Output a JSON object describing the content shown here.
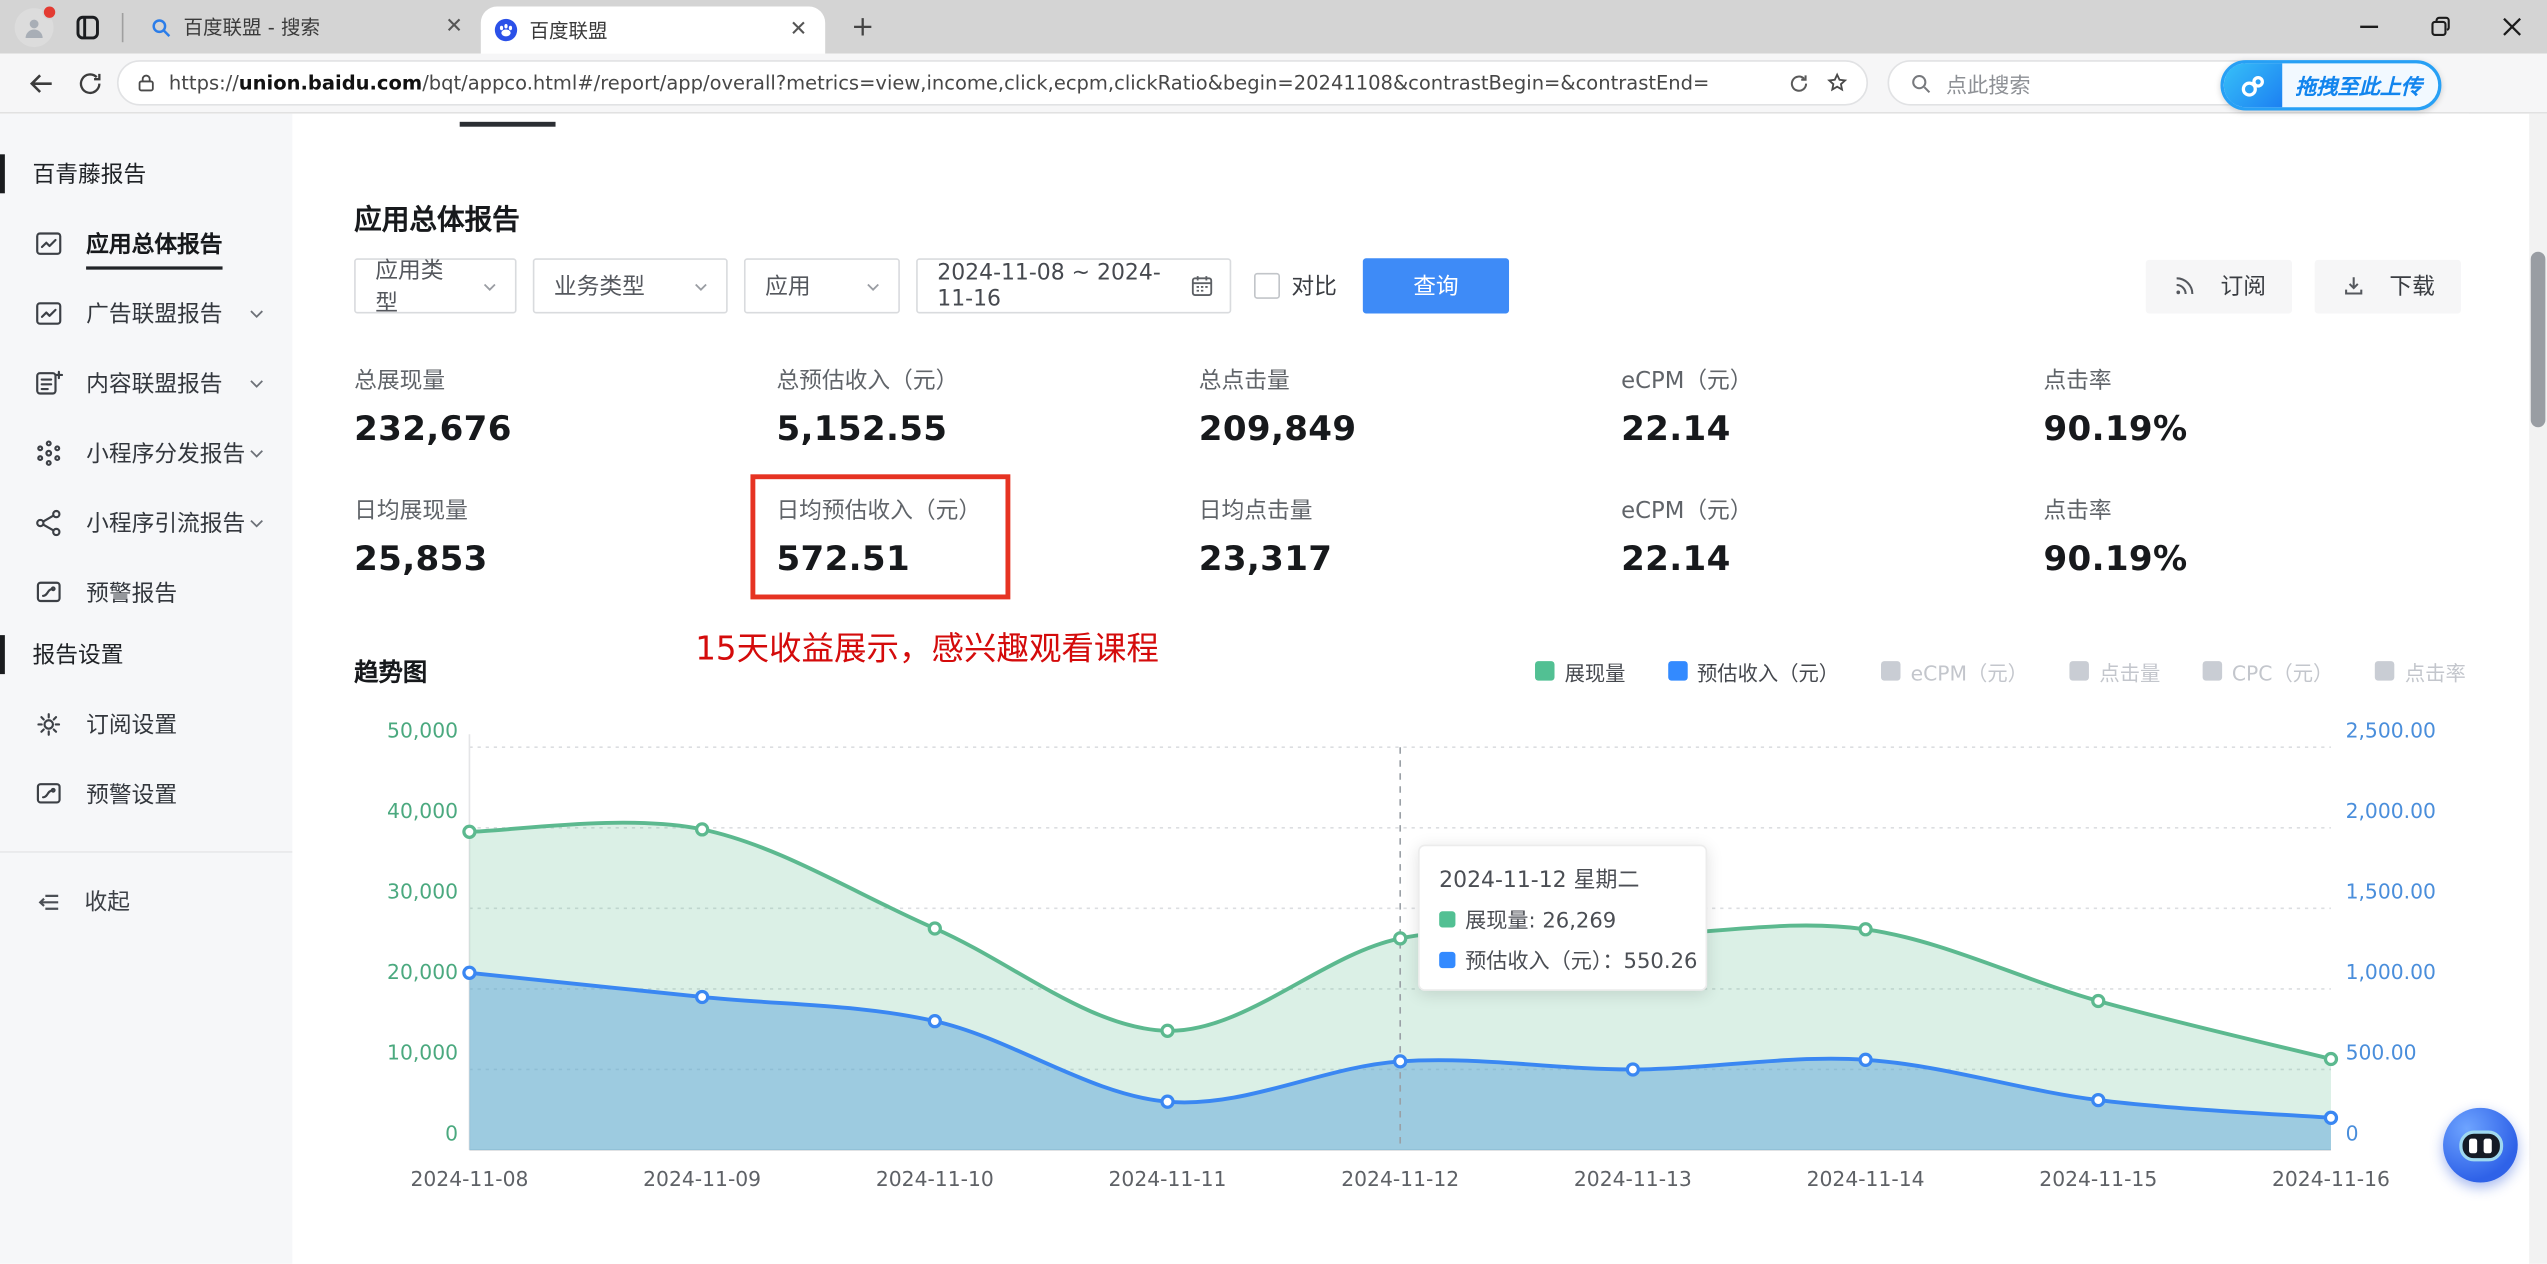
{
  "browser": {
    "tabs": [
      {
        "label": "百度联盟 - 搜索",
        "icon": "search-favicon",
        "active": false
      },
      {
        "label": "百度联盟",
        "icon": "baidu-favicon",
        "active": true
      }
    ],
    "url_protocol": "https://",
    "url_domain": "union.baidu.com",
    "url_path": "/bqt/appco.html#/report/app/overall?metrics=view,income,click,ecpm,clickRatio&begin=20241108&contrastBegin=&contrastEnd=",
    "search_placeholder": "点此搜索",
    "upload_button_label": "拖拽至此上传"
  },
  "sidebar": {
    "sections": [
      {
        "header": "百青藤报告",
        "items": [
          {
            "label": "应用总体报告",
            "icon": "report",
            "active": true,
            "chevron": false
          },
          {
            "label": "广告联盟报告",
            "icon": "report",
            "active": false,
            "chevron": true
          },
          {
            "label": "内容联盟报告",
            "icon": "content",
            "active": false,
            "chevron": true
          },
          {
            "label": "小程序分发报告",
            "icon": "dispatch",
            "active": false,
            "chevron": true
          },
          {
            "label": "小程序引流报告",
            "icon": "share",
            "active": false,
            "chevron": true
          },
          {
            "label": "预警报告",
            "icon": "alert",
            "active": false,
            "chevron": false
          }
        ]
      },
      {
        "header": "报告设置",
        "items": [
          {
            "label": "订阅设置",
            "icon": "gear",
            "active": false,
            "chevron": false
          },
          {
            "label": "预警设置",
            "icon": "alert",
            "active": false,
            "chevron": false
          }
        ]
      }
    ],
    "collapse_label": "收起"
  },
  "main": {
    "title": "应用总体报告",
    "filters": {
      "app_type": "应用类型",
      "biz_type": "业务类型",
      "app": "应用",
      "date_range": "2024-11-08 ~ 2024-11-16",
      "compare_label": "对比",
      "query_label": "查询"
    },
    "actions": {
      "subscribe_label": "订阅",
      "download_label": "下载"
    },
    "metrics_rows": [
      [
        {
          "label": "总展现量",
          "value": "232,676",
          "highlight": false
        },
        {
          "label": "总预估收入（元）",
          "value": "5,152.55",
          "highlight": false
        },
        {
          "label": "总点击量",
          "value": "209,849",
          "highlight": false
        },
        {
          "label": "eCPM（元）",
          "value": "22.14",
          "highlight": false
        },
        {
          "label": "点击率",
          "value": "90.19%",
          "highlight": false
        }
      ],
      [
        {
          "label": "日均展现量",
          "value": "25,853",
          "highlight": false
        },
        {
          "label": "日均预估收入（元）",
          "value": "572.51",
          "highlight": true
        },
        {
          "label": "日均点击量",
          "value": "23,317",
          "highlight": false
        },
        {
          "label": "eCPM（元）",
          "value": "22.14",
          "highlight": false
        },
        {
          "label": "点击率",
          "value": "90.19%",
          "highlight": false
        }
      ]
    ],
    "annotation": "15天收益展示，感兴趣观看课程",
    "chart_title": "趋势图"
  },
  "chart_data": {
    "type": "area",
    "title": "趋势图",
    "x": [
      "2024-11-08",
      "2024-11-09",
      "2024-11-10",
      "2024-11-11",
      "2024-11-12",
      "2024-11-13",
      "2024-11-14",
      "2024-11-15",
      "2024-11-16"
    ],
    "series": [
      {
        "name": "展现量",
        "axis": "left",
        "color": "#5cb98f",
        "fill": "rgba(92,185,143,0.22)",
        "values": [
          39500,
          39800,
          27500,
          14800,
          26269,
          26600,
          27400,
          18500,
          11300
        ]
      },
      {
        "name": "预估收入（元）",
        "axis": "right",
        "color": "#3a87f2",
        "fill": "rgba(96,165,218,0.5)",
        "values": [
          1100,
          950,
          800,
          300,
          550.26,
          500,
          560,
          310,
          200
        ]
      }
    ],
    "left_axis": {
      "color": "#4ba97f",
      "max": 50000,
      "ticks": [
        "50,000",
        "40,000",
        "30,000",
        "20,000",
        "10,000",
        "0"
      ]
    },
    "right_axis": {
      "color": "#4a8edb",
      "max": 2500,
      "ticks": [
        "2,500.00",
        "2,000.00",
        "1,500.00",
        "1,000.00",
        "500.00",
        "0"
      ]
    },
    "legend": [
      {
        "label": "展现量",
        "color": "#52c093",
        "active": true
      },
      {
        "label": "预估收入（元）",
        "color": "#338aff",
        "active": true
      },
      {
        "label": "eCPM（元）",
        "color": "#c9cdd4",
        "active": false
      },
      {
        "label": "点击量",
        "color": "#c9cdd4",
        "active": false
      },
      {
        "label": "CPC（元）",
        "color": "#c9cdd4",
        "active": false
      },
      {
        "label": "点击率",
        "color": "#c9cdd4",
        "active": false
      }
    ],
    "tooltip": {
      "title": "2024-11-12 星期二",
      "x_index": 4,
      "lines": [
        {
          "text": "展现量: 26,269",
          "color": "#52c093"
        },
        {
          "text": "预估收入（元）：550.26",
          "color": "#338aff"
        }
      ]
    },
    "grid": "horizontal-dotted",
    "legend_position": "top-right"
  }
}
